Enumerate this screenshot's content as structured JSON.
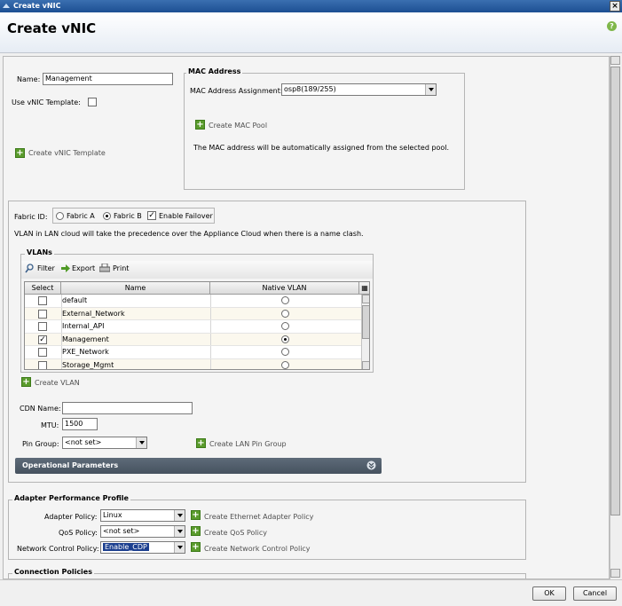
{
  "window": {
    "title": "Create vNIC",
    "close_glyph": "×"
  },
  "header": {
    "title": "Create vNIC",
    "help_glyph": "?"
  },
  "form": {
    "name_label": "Name:",
    "name_value": "Management",
    "use_template_label": "Use vNIC Template:",
    "create_template_label": "Create vNIC Template"
  },
  "mac": {
    "legend": "MAC Address",
    "assignment_label": "MAC Address Assignment:",
    "assignment_value": "osp8(189/255)",
    "create_pool_label": "Create MAC Pool",
    "note": "The MAC address will be automatically assigned from the selected pool."
  },
  "fabric": {
    "label": "Fabric ID:",
    "option_a": "Fabric A",
    "option_b": "Fabric B",
    "selected": "Fabric B",
    "failover_label": "Enable Failover",
    "failover_checked": true,
    "note": "VLAN in LAN cloud will take the precedence over the Appliance Cloud when there is a name clash."
  },
  "vlans": {
    "legend": "VLANs",
    "toolbar": {
      "filter": "Filter",
      "export": "Export",
      "print": "Print"
    },
    "columns": {
      "select": "Select",
      "name": "Name",
      "native": "Native VLAN"
    },
    "rows": [
      {
        "name": "default",
        "selected": false,
        "native": false
      },
      {
        "name": "External_Network",
        "selected": false,
        "native": false
      },
      {
        "name": "Internal_API",
        "selected": false,
        "native": false
      },
      {
        "name": "Management",
        "selected": true,
        "native": true
      },
      {
        "name": "PXE_Network",
        "selected": false,
        "native": false
      },
      {
        "name": "Storage_Mgmt",
        "selected": false,
        "native": false
      }
    ],
    "create_vlan_label": "Create VLAN"
  },
  "cdn": {
    "label": "CDN Name:",
    "value": ""
  },
  "mtu": {
    "label": "MTU:",
    "value": "1500"
  },
  "pin_group": {
    "label": "Pin Group:",
    "value": "<not set>",
    "create_label": "Create LAN Pin Group"
  },
  "operational_parameters": {
    "label": "Operational Parameters"
  },
  "adapter_profile": {
    "legend": "Adapter Performance Profile",
    "adapter_policy_label": "Adapter Policy:",
    "adapter_policy_value": "Linux",
    "create_adapter_label": "Create Ethernet Adapter Policy",
    "qos_label": "QoS Policy:",
    "qos_value": "<not set>",
    "create_qos_label": "Create QoS Policy",
    "ncp_label": "Network Control Policy:",
    "ncp_value": "Enable_CDP",
    "create_ncp_label": "Create Network Control Policy"
  },
  "connection_policies": {
    "legend": "Connection Policies"
  },
  "footer": {
    "ok": "OK",
    "cancel": "Cancel"
  }
}
